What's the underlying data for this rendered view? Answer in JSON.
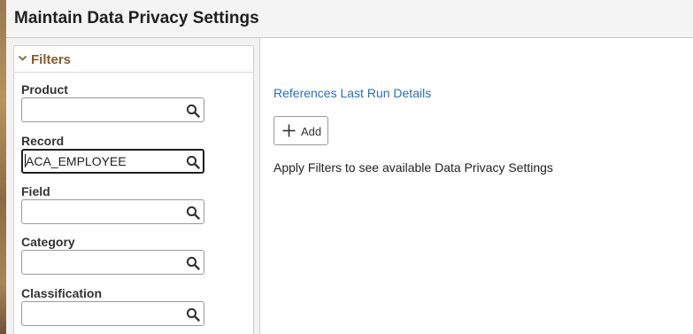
{
  "page": {
    "title": "Maintain Data Privacy Settings"
  },
  "filters": {
    "title": "Filters",
    "expanded_icon": "chevron-down-icon",
    "fields": [
      {
        "label": "Product",
        "value": ""
      },
      {
        "label": "Record",
        "value": "ACA_EMPLOYEE"
      },
      {
        "label": "Field",
        "value": ""
      },
      {
        "label": "Category",
        "value": ""
      },
      {
        "label": "Classification",
        "value": ""
      }
    ],
    "search_icon": "search-icon"
  },
  "main": {
    "link_label": "References Last Run Details",
    "add_label": "Add",
    "add_icon": "plus-icon",
    "message": "Apply Filters to see available Data Privacy Settings"
  },
  "colors": {
    "filters_title": "#8b5a2b",
    "link": "#2a6ebb",
    "header_bg": "#f4f4f4",
    "sidebar_bg": "#f2f2f2"
  }
}
